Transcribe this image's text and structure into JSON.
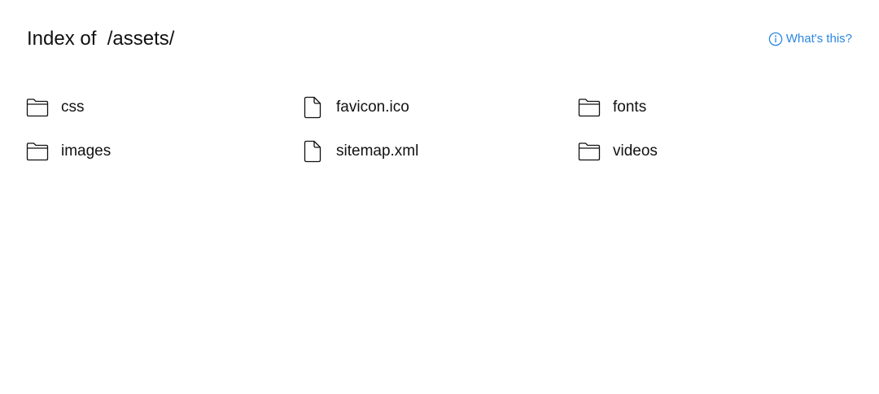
{
  "header": {
    "title_prefix": "Index of",
    "path": "/assets/",
    "help_label": "What's this?"
  },
  "entries": [
    {
      "name": "css",
      "type": "folder",
      "icon": "folder-icon"
    },
    {
      "name": "favicon.ico",
      "type": "file",
      "icon": "file-icon"
    },
    {
      "name": "fonts",
      "type": "folder",
      "icon": "folder-icon"
    },
    {
      "name": "images",
      "type": "folder",
      "icon": "folder-icon"
    },
    {
      "name": "sitemap.xml",
      "type": "file",
      "icon": "file-icon"
    },
    {
      "name": "videos",
      "type": "folder",
      "icon": "folder-icon"
    }
  ],
  "colors": {
    "text": "#111111",
    "link": "#2b87e0",
    "background": "#ffffff"
  }
}
